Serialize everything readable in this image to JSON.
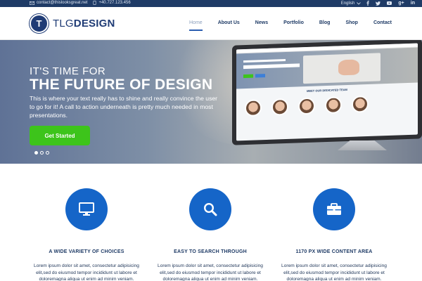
{
  "topbar": {
    "email": "contact@thislooksgreat.net",
    "phone": "+40.727.123.456",
    "language": "English",
    "social_icons": [
      "facebook-icon",
      "twitter-icon",
      "youtube-icon",
      "google-plus-icon",
      "linkedin-icon"
    ]
  },
  "header": {
    "logo_prefix": "TLG",
    "logo_suffix": "DESIGN",
    "logo_badge": "T",
    "nav": [
      "Home",
      "About Us",
      "News",
      "Portfolio",
      "Blog",
      "Shop",
      "Contact"
    ],
    "active_nav": "Home"
  },
  "hero": {
    "title_line1": "IT'S TIME FOR",
    "title_line2": "THE FUTURE OF DESIGN",
    "body": "This is where your text really has to shine and really convince the user to go for it! A call to action underneath is pretty much needed in most presentations.",
    "cta_label": "Get Started",
    "screen_team_label": "MEET OUR DEDICATED TEAM",
    "slide_count": 3,
    "active_slide": 1
  },
  "features": [
    {
      "icon": "monitor-icon",
      "title": "A WIDE VARIETY OF CHOICES",
      "text": "Lorem ipsum dolor sit amet, consectetur adipisicing elit,sed do eiusmod tempor incididunt ut labore et doloremagna aliqua ut enim ad minim veniam."
    },
    {
      "icon": "search-icon",
      "title": "EASY TO SEARCH THROUGH",
      "text": "Lorem ipsum dolor sit amet, consectetur adipisicing elit,sed do eiusmod tempor incididunt ut labore et doloremagna aliqua ut enim ad minim veniam."
    },
    {
      "icon": "briefcase-icon",
      "title": "1170 PX WIDE CONTENT AREA",
      "text": "Lorem ipsum dolor sit amet, consectetur adipisicing elit,sed do eiusmod tempor incididunt ut labore et doloremagna aliqua ut enim ad minim veniam."
    }
  ],
  "colors": {
    "brand_navy": "#1f3b66",
    "accent_blue": "#1565c8",
    "cta_green": "#3dc41b"
  }
}
